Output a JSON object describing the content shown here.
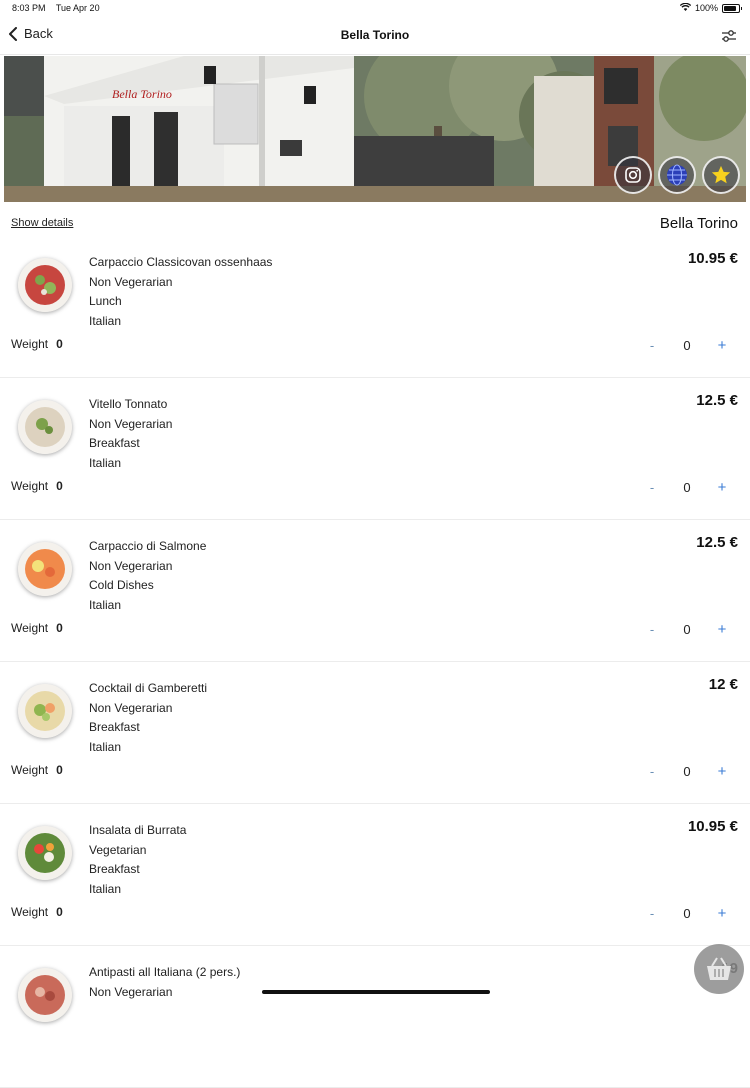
{
  "status_bar": {
    "time": "8:03 PM",
    "date": "Tue Apr 20",
    "battery": "100%"
  },
  "nav": {
    "back_label": "Back",
    "title": "Bella Torino"
  },
  "hero": {
    "sign_text": "Bella Torino"
  },
  "info": {
    "show_details": "Show details",
    "restaurant_name": "Bella Torino"
  },
  "items": [
    {
      "name": "Carpaccio Classicovan ossenhaas",
      "diet": "Non Vegerarian",
      "meal": "Lunch",
      "cuisine": "Italian",
      "price": "10.95 €",
      "weight_label": "Weight",
      "weight": "0",
      "qty": "0",
      "minus": "-",
      "plus": "+"
    },
    {
      "name": "Vitello Tonnato",
      "diet": "Non Vegerarian",
      "meal": "Breakfast",
      "cuisine": "Italian",
      "price": "12.5 €",
      "weight_label": "Weight",
      "weight": "0",
      "qty": "0",
      "minus": "-",
      "plus": "+"
    },
    {
      "name": "Carpaccio di Salmone",
      "diet": "Non Vegerarian",
      "meal": "Cold Dishes",
      "cuisine": "Italian",
      "price": "12.5 €",
      "weight_label": "Weight",
      "weight": "0",
      "qty": "0",
      "minus": "-",
      "plus": "+"
    },
    {
      "name": "Cocktail di Gamberetti",
      "diet": "Non Vegerarian",
      "meal": "Breakfast",
      "cuisine": "Italian",
      "price": "12 €",
      "weight_label": "Weight",
      "weight": "0",
      "qty": "0",
      "minus": "-",
      "plus": "+"
    },
    {
      "name": "Insalata di Burrata",
      "diet": "Vegetarian",
      "meal": "Breakfast",
      "cuisine": "Italian",
      "price": "10.95 €",
      "weight_label": "Weight",
      "weight": "0",
      "qty": "0",
      "minus": "-",
      "plus": "+"
    },
    {
      "name": "Antipasti all Italiana (2 pers.)",
      "diet": "Non Vegerarian",
      "meal": "",
      "cuisine": "",
      "price": "19",
      "weight_label": "",
      "weight": "",
      "qty": "",
      "minus": "",
      "plus": ""
    }
  ],
  "icons": {
    "back": "chevron-left-icon",
    "filter": "sliders-icon",
    "instagram": "instagram-icon",
    "web": "globe-icon",
    "favorite": "star-icon",
    "cart": "basket-icon"
  },
  "colors": {
    "accent": "#3a7bd5",
    "star": "#f7d11e",
    "divider": "#ececec"
  }
}
